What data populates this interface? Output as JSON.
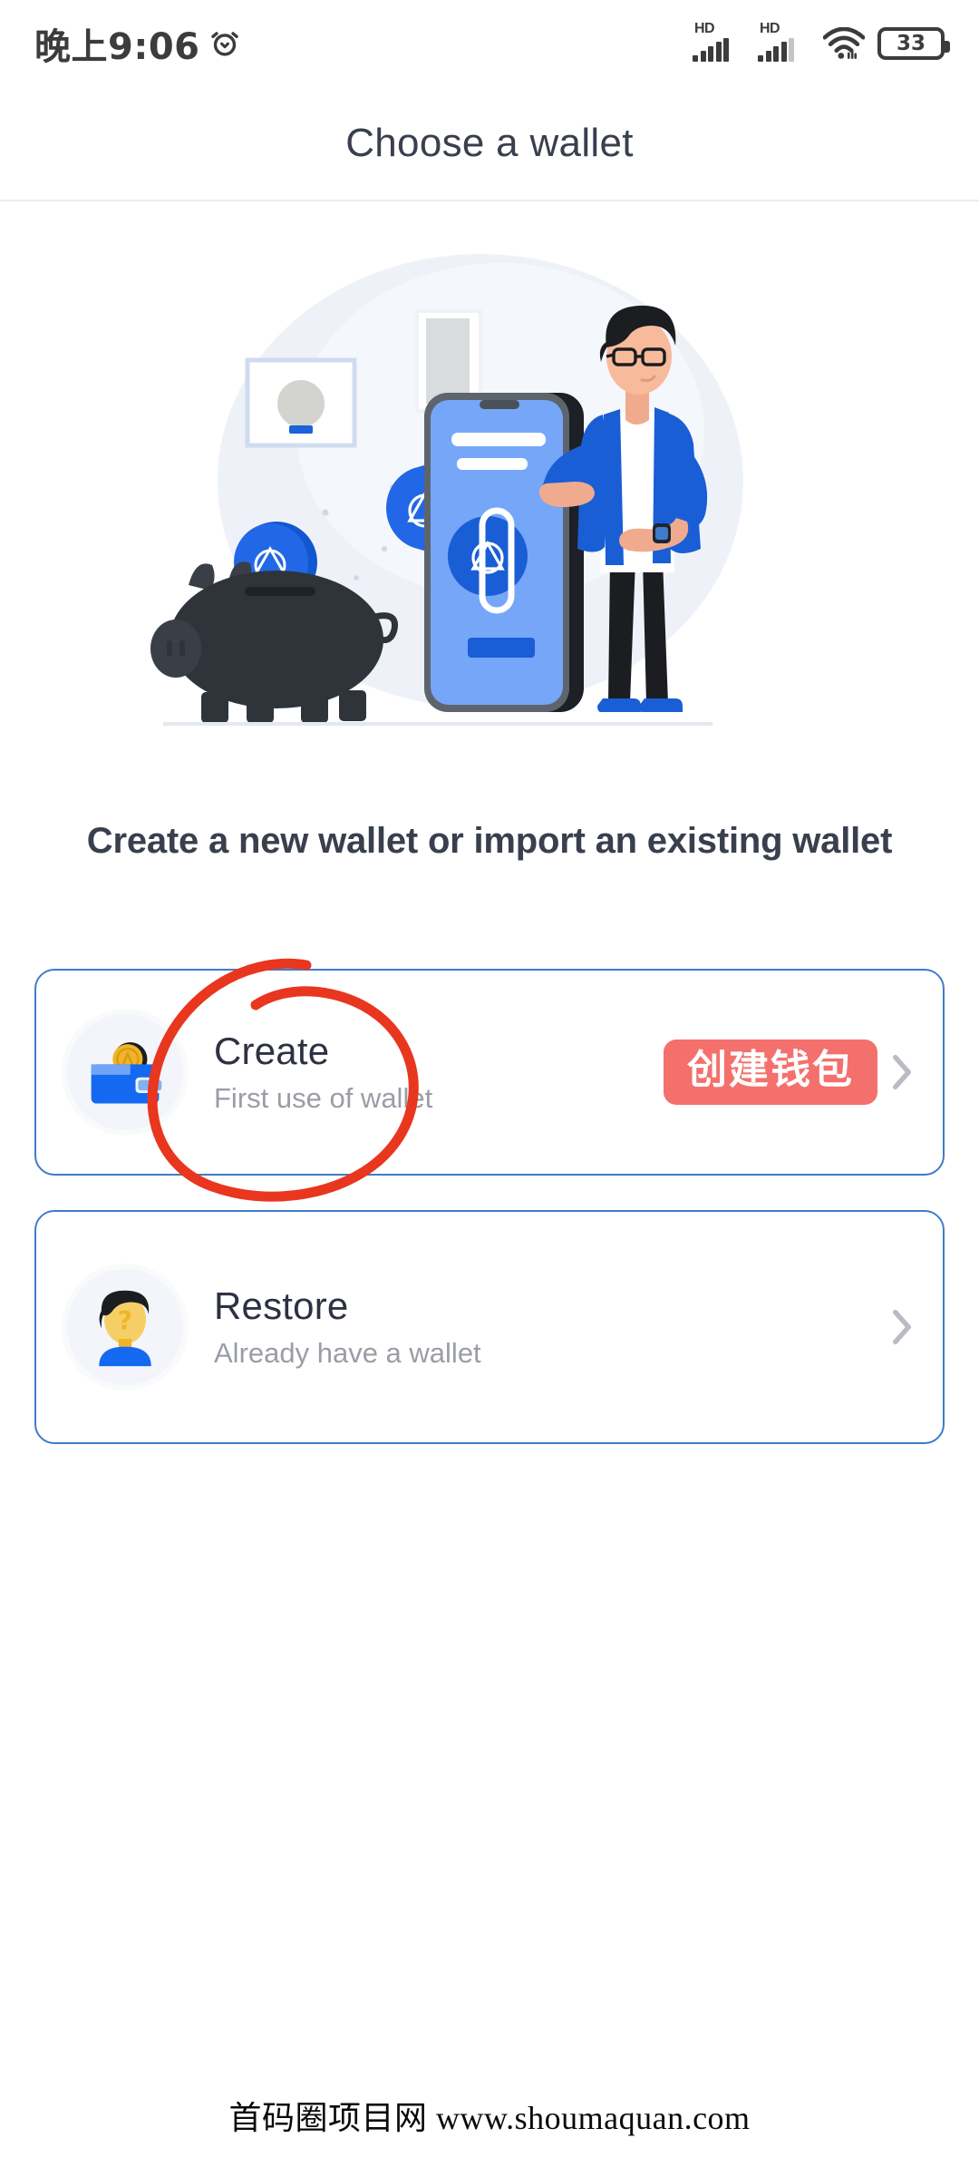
{
  "statusbar": {
    "time": "晚上9:06",
    "alarm_icon": "alarm-clock-icon",
    "signal_1": {
      "icon": "hd-signal-icon",
      "label": "HD",
      "bars": 4
    },
    "signal_2": {
      "icon": "hd-signal-icon",
      "label": "HD",
      "bars": 4
    },
    "wifi": {
      "icon": "wifi-icon"
    },
    "battery": {
      "icon": "battery-icon",
      "percent": "33"
    }
  },
  "header": {
    "title": "Choose a wallet"
  },
  "hero": {
    "illustration_name": "wallet-savings-illustration",
    "elements": [
      "piggy-bank",
      "coin-with-a-logo",
      "smartphone",
      "standing-man",
      "framed-picture",
      "wall-poster"
    ]
  },
  "main": {
    "subtitle": "Create a new wallet or import an existing wallet",
    "options": [
      {
        "id": "create",
        "icon": "wallet-with-coin-icon",
        "title": "Create",
        "subtitle": "First use of wallet",
        "badge": "创建钱包",
        "chevron": "chevron-right-icon"
      },
      {
        "id": "restore",
        "icon": "person-question-avatar-icon",
        "title": "Restore",
        "subtitle": "Already have a wallet",
        "badge": "",
        "chevron": "chevron-right-icon"
      }
    ]
  },
  "annotation": {
    "name": "red-circle-highlight",
    "color": "#e8361f",
    "targets": "create-option"
  },
  "footer": {
    "watermark": "首码圈项目网 www.shoumaquan.com"
  },
  "colors": {
    "accent_blue": "#3f7cc9",
    "badge_red": "#f4706d",
    "title_dark": "#3a3f4e",
    "sub_grey": "#9a9da6",
    "annotation_red": "#e8361f"
  }
}
